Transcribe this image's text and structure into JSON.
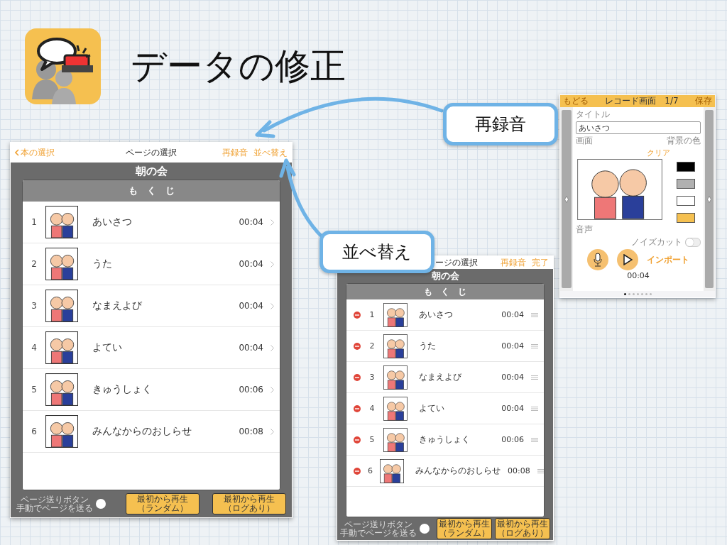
{
  "title": "データの修正",
  "screens": [
    {
      "kind": "browse",
      "nav": {
        "back": "本の選択",
        "title": "ページの選択",
        "actions": [
          "再録音",
          "並べ替え"
        ]
      },
      "book_title": "朝の会",
      "contents_header": "も　く　じ",
      "rows": [
        {
          "number": "1",
          "title": "あいさつ",
          "duration": "00:04"
        },
        {
          "number": "2",
          "title": "うた",
          "duration": "00:04"
        },
        {
          "number": "3",
          "title": "なまえよび",
          "duration": "00:04"
        },
        {
          "number": "4",
          "title": "よてい",
          "duration": "00:04"
        },
        {
          "number": "5",
          "title": "きゅうしょく",
          "duration": "00:06"
        },
        {
          "number": "6",
          "title": "みんなからのおしらせ",
          "duration": "00:08"
        }
      ],
      "footer": {
        "toggle_label": "ページ送りボタン",
        "toggle_hint": "手動でページを送る",
        "toggle_on": false,
        "buttons": [
          {
            "line1": "最初から再生",
            "line2": "（ランダム）"
          },
          {
            "line1": "最初から再生",
            "line2": "（ログあり）"
          }
        ]
      }
    },
    {
      "kind": "reorder",
      "nav": {
        "title": "ージの選択",
        "actions": [
          "再録音",
          "完了"
        ]
      },
      "book_title": "朝の会",
      "contents_header": "も　く　じ",
      "rows": [
        {
          "number": "1",
          "title": "あいさつ",
          "duration": "00:04"
        },
        {
          "number": "2",
          "title": "うた",
          "duration": "00:04"
        },
        {
          "number": "3",
          "title": "なまえよび",
          "duration": "00:04"
        },
        {
          "number": "4",
          "title": "よてい",
          "duration": "00:04"
        },
        {
          "number": "5",
          "title": "きゅうしょく",
          "duration": "00:06"
        },
        {
          "number": "6",
          "title": "みんなからのおしらせ",
          "duration": "00:08"
        }
      ],
      "footer": {
        "toggle_label": "ページ送りボタン",
        "toggle_hint": "手動でページを送る",
        "toggle_on": false,
        "buttons": [
          {
            "line1": "最初から再生",
            "line2": "（ランダム）"
          },
          {
            "line1": "最初から再生",
            "line2": "（ログあり）"
          }
        ]
      }
    }
  ],
  "editor": {
    "top_bar": {
      "back": "もどる",
      "title": "レコード画面　1/7",
      "save": "保存"
    },
    "title_label": "タイトル",
    "title_value": "あいさつ",
    "picture_label": "画面",
    "color_label": "背景の色",
    "clear": "クリア",
    "swatches": [
      {
        "color": "#000000"
      },
      {
        "color": "#b0b0b0"
      },
      {
        "color": "#ffffff"
      },
      {
        "color": "#f5c050"
      }
    ],
    "sound_label": "音声",
    "noise_cut": {
      "label": "ノイズカット",
      "on": false
    },
    "import": "インポート",
    "time": "00:04",
    "page_dots": [
      {
        "selected": true
      },
      {
        "selected": false
      },
      {
        "selected": false
      },
      {
        "selected": false
      },
      {
        "selected": false
      },
      {
        "selected": false
      },
      {
        "selected": false
      }
    ]
  },
  "callouts": [
    {
      "text": "再録音"
    },
    {
      "text": "並べ替え"
    }
  ]
}
